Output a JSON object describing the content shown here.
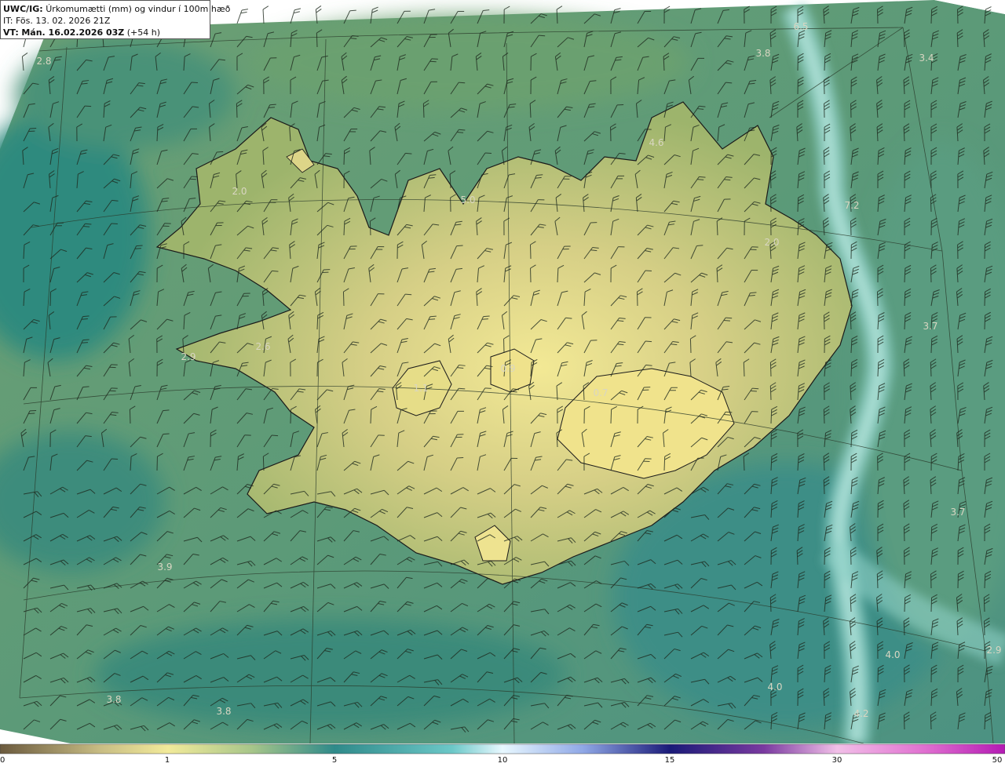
{
  "header": {
    "code": "UWC/IG:",
    "title": "Úrkomumætti (mm) og vindur í 100m hæð",
    "init_time": "IT: Fös. 13. 02. 2026 21Z",
    "valid_prefix": "VT:",
    "valid_time": "Mán. 16.02.2026 03Z",
    "lead": "(+54 h)"
  },
  "value_labels": [
    {
      "text": "2.8"
    },
    {
      "text": "6.5"
    },
    {
      "text": "3.8"
    },
    {
      "text": "3.4"
    },
    {
      "text": "4.6"
    },
    {
      "text": "5.0"
    },
    {
      "text": "2.0"
    },
    {
      "text": "7.2"
    },
    {
      "text": "2.0"
    },
    {
      "text": "3.7"
    },
    {
      "text": "2.9"
    },
    {
      "text": "2.6"
    },
    {
      "text": "0.9"
    },
    {
      "text": "1.1"
    },
    {
      "text": "0.7"
    },
    {
      "text": "3.7"
    },
    {
      "text": "3.9"
    },
    {
      "text": "4.0"
    },
    {
      "text": "2.9"
    },
    {
      "text": "4.0"
    },
    {
      "text": "3.8"
    },
    {
      "text": "3.8"
    },
    {
      "text": "4.2"
    }
  ],
  "colorbar": {
    "unit": "mm",
    "ticks": [
      "0",
      "1",
      "5",
      "10",
      "15",
      "30",
      "50"
    ],
    "colors": [
      "#6b5a3e",
      "#d4c98a",
      "#f2ea9a",
      "#6fa88e",
      "#2f8a8a",
      "#a9f2f2",
      "#e8f4ff",
      "#6e80d8",
      "#1a1a78",
      "#8a3aa0",
      "#f29ad8",
      "#ffd0f0",
      "#c23ac2"
    ]
  },
  "colors": {
    "sea_dark": "#2f8a7c",
    "sea_mid": "#5f9a74",
    "land_low": "#9cb46a",
    "land_high": "#f0e58e",
    "jet_band": "#8fd0c8"
  }
}
